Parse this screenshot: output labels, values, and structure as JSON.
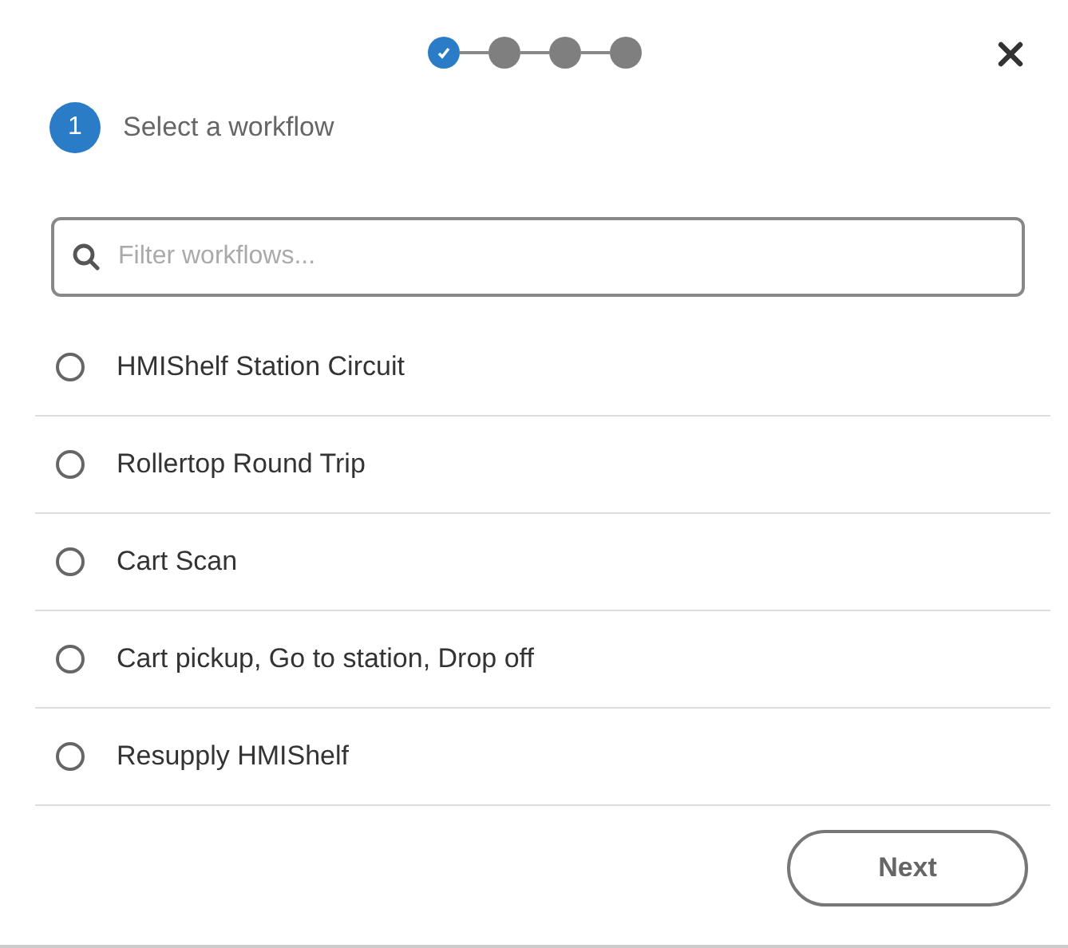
{
  "stepper": [
    {
      "done": true
    },
    {
      "done": false
    },
    {
      "done": false
    },
    {
      "done": false
    }
  ],
  "step": {
    "number": "1",
    "title": "Select a workflow"
  },
  "search": {
    "placeholder": "Filter workflows..."
  },
  "workflows": [
    {
      "label": "HMIShelf Station Circuit",
      "selected": false
    },
    {
      "label": "Rollertop Round Trip",
      "selected": false
    },
    {
      "label": "Cart Scan",
      "selected": false
    },
    {
      "label": "Cart pickup, Go to station, Drop off",
      "selected": false
    },
    {
      "label": "Resupply HMIShelf",
      "selected": false
    }
  ],
  "next_button": "Next"
}
